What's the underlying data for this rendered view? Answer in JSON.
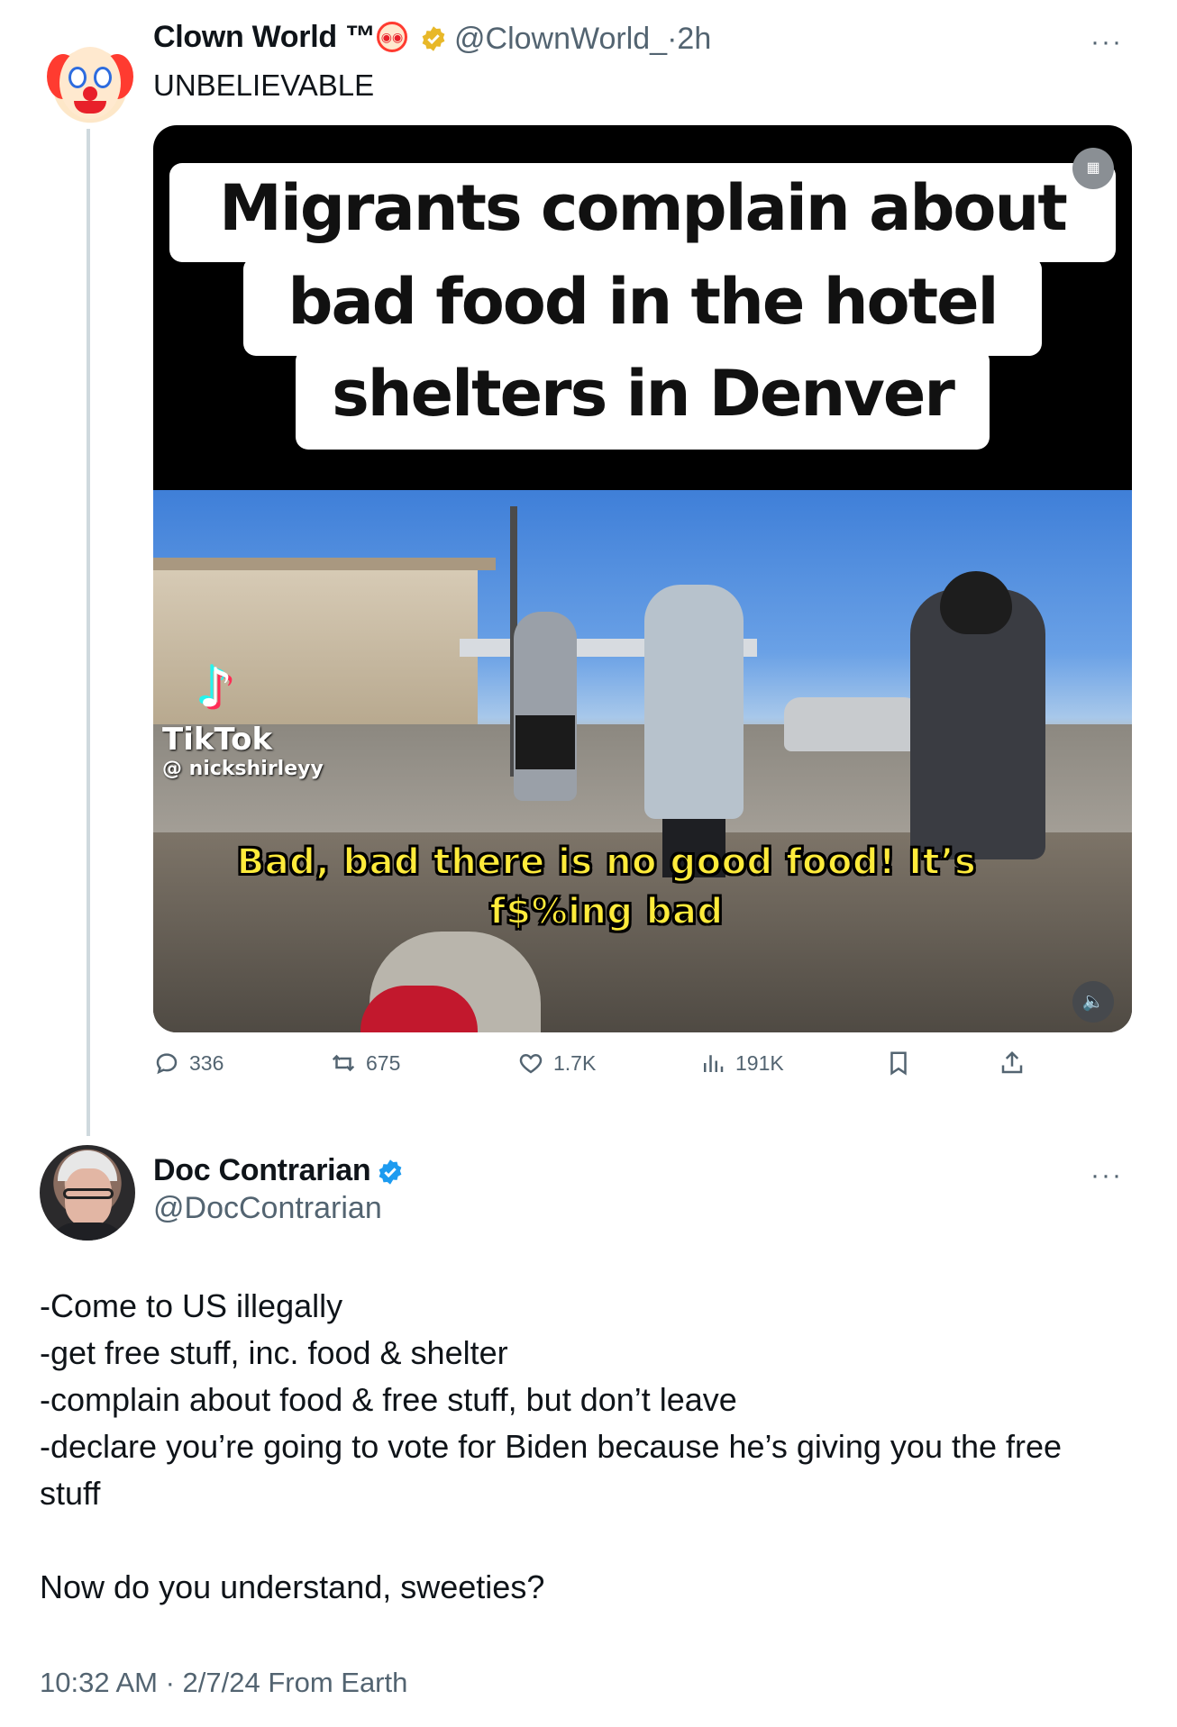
{
  "tweet1": {
    "display_name": "Clown World ™",
    "name_emoji": "clown-face-emoji",
    "handle": "@ClownWorld_",
    "separator": "·",
    "time": "2h",
    "more": "···",
    "text": "UNBELIEVABLE",
    "media": {
      "caption_lines": [
        "Migrants complain about",
        "bad food in the hotel",
        "shelters in Denver"
      ],
      "watermark_app": "TikTok",
      "watermark_user": "@ nickshirleyy",
      "subtitle_lines": [
        "Bad, bad there is no good food! It’s",
        "f$%ing bad"
      ],
      "sound_icon": "speaker-icon",
      "alt_icon": "image-icon"
    },
    "actions": {
      "replies": "336",
      "reposts": "675",
      "likes": "1.7K",
      "views": "191K"
    }
  },
  "tweet2": {
    "display_name": "Doc Contrarian",
    "handle": "@DocContrarian",
    "more": "···",
    "body_lines": [
      "-Come to US illegally",
      "-get free stuff, inc. food & shelter",
      "-complain about food & free stuff, but don’t leave",
      "-declare you’re going to vote for Biden because he’s giving you the free",
      "stuff"
    ],
    "closing": "Now do you understand, sweeties?",
    "meta": "10:32 AM · 2/7/24 From Earth"
  },
  "colors": {
    "verified_gold": "#e8b829",
    "verified_blue": "#1d9bf0",
    "muted_text": "#536471",
    "subtitle_yellow": "#ffeb3b"
  }
}
